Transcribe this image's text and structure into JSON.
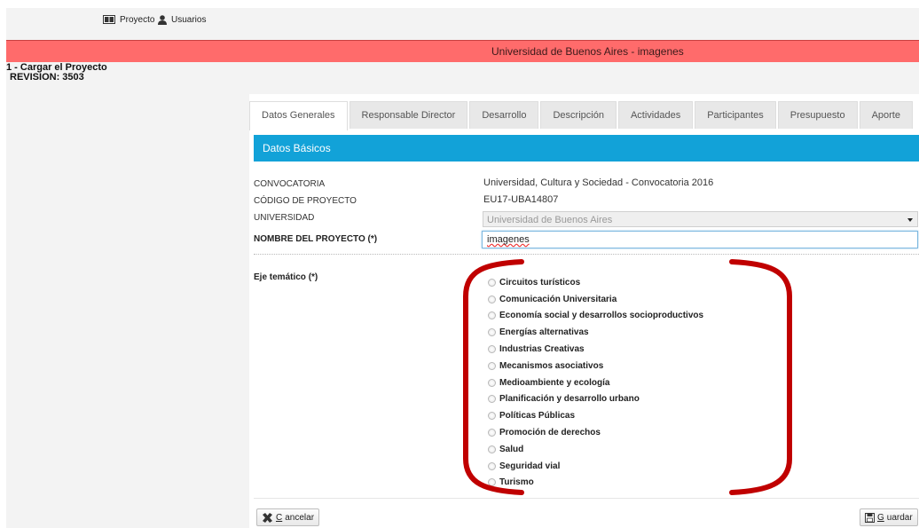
{
  "topnav": {
    "proyecto_label": "Proyecto",
    "usuarios_label": "Usuarios"
  },
  "banner": {
    "title": "Universidad de Buenos Aires - imagenes"
  },
  "sidebar": {
    "step_title": "1 - Cargar el Proyecto",
    "revision": "REVISION: 3503"
  },
  "tabs": [
    {
      "label": "Datos Generales",
      "active": true
    },
    {
      "label": "Responsable Director"
    },
    {
      "label": "Desarrollo"
    },
    {
      "label": "Descripción"
    },
    {
      "label": "Actividades"
    },
    {
      "label": "Participantes"
    },
    {
      "label": "Presupuesto"
    },
    {
      "label": "Aporte"
    }
  ],
  "section": {
    "title": "Datos Básicos"
  },
  "fields": {
    "convocatoria_label": "CONVOCATORIA",
    "convocatoria_value": "Universidad, Cultura y Sociedad - Convocatoria 2016",
    "codigo_label": "CÓDIGO DE PROYECTO",
    "codigo_value": "EU17-UBA14807",
    "universidad_label": "UNIVERSIDAD",
    "universidad_value": "Universidad de Buenos Aires",
    "nombre_label": "NOMBRE DEL PROYECTO (*)",
    "nombre_value": "imagenes"
  },
  "eje": {
    "label": "Eje temático (*)",
    "options": [
      "Circuitos turísticos",
      "Comunicación Universitaria",
      "Economía social y desarrollos socioproductivos",
      "Energías alternativas",
      "Industrias Creativas",
      "Mecanismos asociativos",
      "Medioambiente y ecología",
      "Planificación y desarrollo urbano",
      "Políticas Públicas",
      "Promoción de derechos",
      "Salud",
      "Seguridad vial",
      "Turismo"
    ]
  },
  "buttons": {
    "cancel_first": "C",
    "cancel_rest": "ancelar",
    "save_first": "G",
    "save_rest": "uardar"
  },
  "colors": {
    "banner": "#ff6b6b",
    "section": "#12a2d8",
    "annotation": "#c00000"
  }
}
